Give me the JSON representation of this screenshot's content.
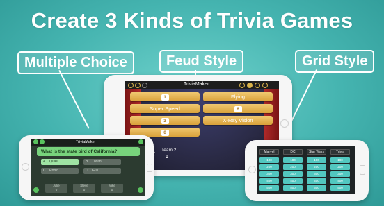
{
  "headline": "Create 3 Kinds of Trivia Games",
  "tags": {
    "multiple_choice": "Multiple Choice",
    "feud_style": "Feud Style",
    "grid_style": "Grid Style"
  },
  "center_phone": {
    "app_name": "TriviaMaker",
    "tiles": [
      {
        "text": "1",
        "kind": "num"
      },
      {
        "text": "Flying",
        "kind": "text"
      },
      {
        "text": "Super Speed",
        "kind": "text"
      },
      {
        "text": "6",
        "kind": "num"
      },
      {
        "text": "3",
        "kind": "num"
      },
      {
        "text": "X-Ray Vision",
        "kind": "text"
      },
      {
        "text": "0",
        "kind": "num"
      }
    ],
    "team1_label": "m 1",
    "team1_score": "00",
    "team2_label": "Team 2",
    "team2_score": "0"
  },
  "left_phone": {
    "app_name": "TriviaMaker",
    "question": "What is the state bird of California?",
    "answers": [
      {
        "letter": "A",
        "text": "Quail"
      },
      {
        "letter": "B",
        "text": "Tucan"
      },
      {
        "letter": "C",
        "text": "Robin"
      },
      {
        "letter": "D",
        "text": "Gull"
      }
    ],
    "bottom": [
      {
        "label": "Julie",
        "value": "0"
      },
      {
        "label": "Steve",
        "value": "0"
      },
      {
        "label": "Mike",
        "value": "0"
      }
    ]
  },
  "right_phone": {
    "headers": [
      "Marvel",
      "DC",
      "Star Wars",
      "Trivia"
    ],
    "rows": [
      [
        "100",
        "100",
        "100",
        "100"
      ],
      [
        "200",
        "200",
        "200",
        "200"
      ],
      [
        "300",
        "300",
        "300",
        "300"
      ],
      [
        "400",
        "400",
        "400",
        "400"
      ],
      [
        "500",
        "500",
        "500",
        "500"
      ]
    ]
  },
  "colors": {
    "background": "#45b4b0",
    "feud_tile": "#e6b655",
    "mc_green": "#78d37c",
    "grid_cell": "#52c7c0"
  }
}
